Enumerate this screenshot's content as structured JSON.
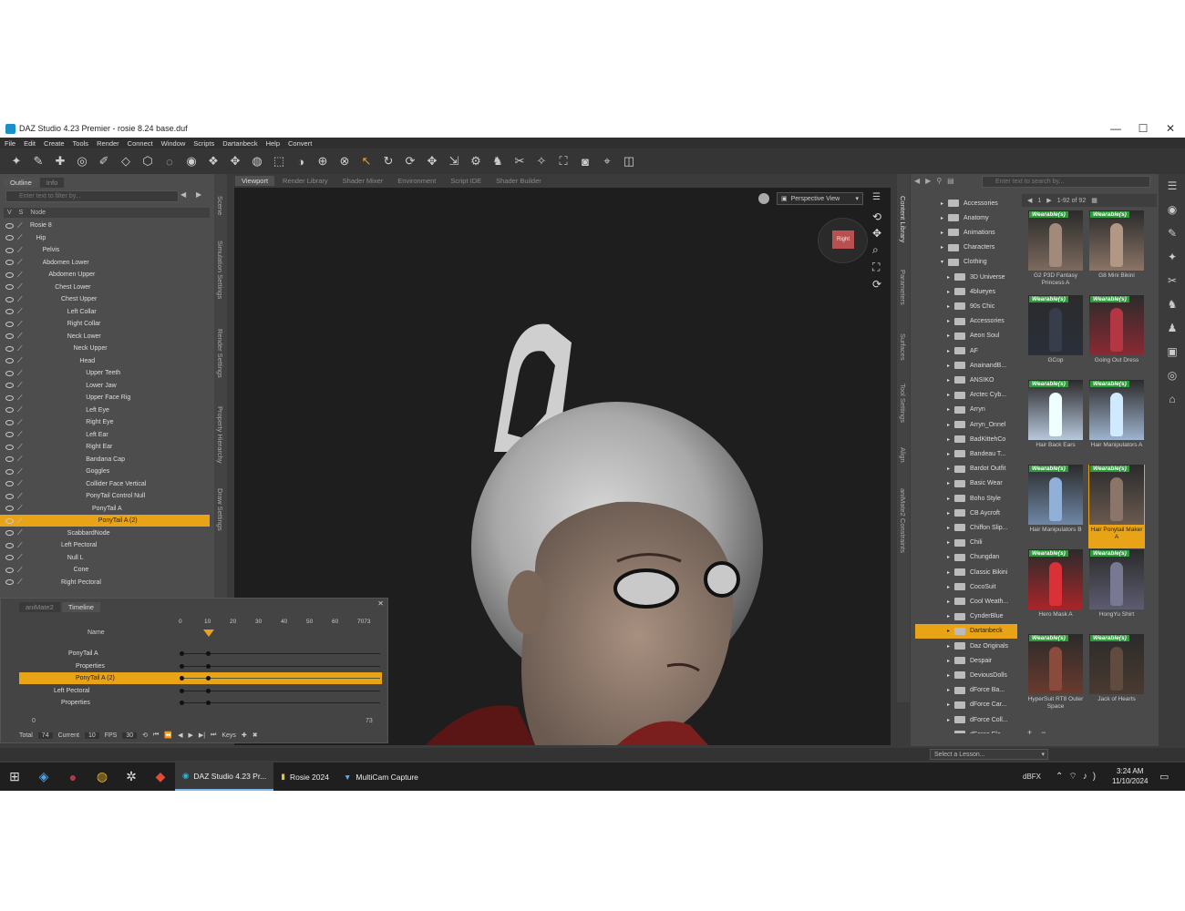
{
  "window": {
    "title": "DAZ Studio 4.23 Premier - rosie 8.24 base.duf",
    "minimize": "—",
    "maximize": "☐",
    "close": "✕"
  },
  "menu": [
    "File",
    "Edit",
    "Create",
    "Tools",
    "Render",
    "Connect",
    "Window",
    "Scripts",
    "Dartanbeck",
    "Help",
    "Convert"
  ],
  "toolbar": {
    "icons": [
      "figure-icon",
      "joint-editor-icon",
      "node-weight-icon",
      "region-nav-icon",
      "surface-select-icon",
      "geometry-icon",
      "polygon-icon",
      "lasso-icon",
      "spot-render-icon",
      "universal-icon",
      "rotate-icon",
      "translate-icon",
      "scale-icon",
      "bend-icon",
      "active-pose-icon",
      "transform-icon",
      "select-icon",
      "orbit-icon",
      "rotate-view-icon",
      "pan-icon",
      "dolly-icon",
      "bone-icon",
      "pose-icon",
      "morph-icon",
      "figure-tool-icon",
      "render-icon",
      "camera-icon",
      "pointer-icon",
      "screenshot-icon"
    ]
  },
  "scene": {
    "tabs": [
      "Outline",
      "Info"
    ],
    "filter_placeholder": "Enter text to filter by...",
    "col_v": "V",
    "col_s": "S",
    "col_node": "Node",
    "nodes": [
      {
        "label": "Rosie 8",
        "indent": 0
      },
      {
        "label": "Hip",
        "indent": 1
      },
      {
        "label": "Pelvis",
        "indent": 2
      },
      {
        "label": "Abdomen Lower",
        "indent": 2
      },
      {
        "label": "Abdomen Upper",
        "indent": 3
      },
      {
        "label": "Chest Lower",
        "indent": 4
      },
      {
        "label": "Chest Upper",
        "indent": 5
      },
      {
        "label": "Left Collar",
        "indent": 6
      },
      {
        "label": "Right Collar",
        "indent": 6
      },
      {
        "label": "Neck Lower",
        "indent": 6
      },
      {
        "label": "Neck Upper",
        "indent": 7
      },
      {
        "label": "Head",
        "indent": 8
      },
      {
        "label": "Upper Teeth",
        "indent": 9
      },
      {
        "label": "Lower Jaw",
        "indent": 9
      },
      {
        "label": "Upper Face Rig",
        "indent": 9
      },
      {
        "label": "Left Eye",
        "indent": 9
      },
      {
        "label": "Right Eye",
        "indent": 9
      },
      {
        "label": "Left Ear",
        "indent": 9
      },
      {
        "label": "Right Ear",
        "indent": 9
      },
      {
        "label": "Bandana Cap",
        "indent": 9
      },
      {
        "label": "Goggles",
        "indent": 9
      },
      {
        "label": "Collider Face Vertical",
        "indent": 9
      },
      {
        "label": "PonyTail Control Null",
        "indent": 9
      },
      {
        "label": "PonyTail A",
        "indent": 10
      },
      {
        "label": "PonyTail A (2)",
        "indent": 11,
        "selected": true
      },
      {
        "label": "ScabbardNode",
        "indent": 6
      },
      {
        "label": "Left Pectoral",
        "indent": 5
      },
      {
        "label": "Null L",
        "indent": 6
      },
      {
        "label": "Cone",
        "indent": 7
      },
      {
        "label": "Right Pectoral",
        "indent": 5
      }
    ]
  },
  "side_tabs_left": [
    "Scene",
    "Simulation Settings",
    "Render Settings",
    "Property Hierarchy",
    "Draw Settings"
  ],
  "side_tabs_right": [
    "Content Library",
    "Parameters",
    "Surfaces",
    "Tool Settings",
    "Align",
    "aniMate2 Constraints"
  ],
  "viewport_tabs": [
    "Viewport",
    "Render Library",
    "Shader Mixer",
    "Environment",
    "Script IDE",
    "Shader Builder"
  ],
  "viewport": {
    "view": "Perspective View",
    "cube_label": "Right"
  },
  "timeline": {
    "tabs": [
      "aniMate2",
      "Timeline"
    ],
    "name_header": "Name",
    "ruler": [
      "0",
      "10",
      "20",
      "30",
      "40",
      "50",
      "60",
      "7073"
    ],
    "rows": [
      {
        "label": "PonyTail A",
        "indent": 3
      },
      {
        "label": "Properties",
        "indent": 4
      },
      {
        "label": "PonyTail A (2)",
        "indent": 4,
        "selected": true
      },
      {
        "label": "Left Pectoral",
        "indent": 1
      },
      {
        "label": "Properties",
        "indent": 2
      }
    ],
    "range_start": "0",
    "range_end": "73",
    "total_label": "Total",
    "total": "74",
    "current_label": "Current",
    "current": "10",
    "fps_label": "FPS",
    "fps": "30",
    "keys_label": "Keys"
  },
  "content": {
    "search_placeholder": "Enter text to search by...",
    "count": "1-92 of 92",
    "page": "1",
    "categories": [
      {
        "label": "Accessories",
        "level": 0
      },
      {
        "label": "Anatomy",
        "level": 0
      },
      {
        "label": "Animations",
        "level": 0
      },
      {
        "label": "Characters",
        "level": 0
      },
      {
        "label": "Clothing",
        "level": 0
      },
      {
        "label": "3D Universe",
        "level": 1
      },
      {
        "label": "4blueyes",
        "level": 1
      },
      {
        "label": "90s Chic",
        "level": 1
      },
      {
        "label": "Accessories",
        "level": 1
      },
      {
        "label": "Aeon Soul",
        "level": 1
      },
      {
        "label": "AF",
        "level": 1
      },
      {
        "label": "AnainandB...",
        "level": 1
      },
      {
        "label": "ANSIKO",
        "level": 1
      },
      {
        "label": "Arctec Cyb...",
        "level": 1
      },
      {
        "label": "Arryn",
        "level": 1
      },
      {
        "label": "Arryn_Onnel",
        "level": 1
      },
      {
        "label": "BadKittehCo",
        "level": 1
      },
      {
        "label": "Bandeau T...",
        "level": 1
      },
      {
        "label": "Bardot Outfit",
        "level": 1
      },
      {
        "label": "Basic Wear",
        "level": 1
      },
      {
        "label": "Boho Style",
        "level": 1
      },
      {
        "label": "CB Aycroft",
        "level": 1
      },
      {
        "label": "Chiffon Slip...",
        "level": 1
      },
      {
        "label": "Chili",
        "level": 1
      },
      {
        "label": "Chungdan",
        "level": 1
      },
      {
        "label": "Classic Bikini",
        "level": 1
      },
      {
        "label": "CocoSuit",
        "level": 1
      },
      {
        "label": "Cool Weath...",
        "level": 1
      },
      {
        "label": "CynderBlue",
        "level": 1
      },
      {
        "label": "Dartanbeck",
        "level": 1,
        "selected": true
      },
      {
        "label": "Daz Originals",
        "level": 1
      },
      {
        "label": "Despair",
        "level": 1
      },
      {
        "label": "DeviousDolls",
        "level": 1
      },
      {
        "label": "dForce Ba...",
        "level": 1
      },
      {
        "label": "dForce Car...",
        "level": 1
      },
      {
        "label": "dForce Coll...",
        "level": 1
      },
      {
        "label": "dForce Ele...",
        "level": 1
      }
    ],
    "badge": "Wearable(s)",
    "items": [
      {
        "label": "G2 P3D Fantasy Princess A",
        "color": "#7c6a5e"
      },
      {
        "label": "G8 Mini Bikini",
        "color": "#8a7466"
      },
      {
        "label": "GCop",
        "color": "#2a2f3a"
      },
      {
        "label": "Going Out Dress",
        "color": "#8a2a33"
      },
      {
        "label": "Hair Back Ears",
        "color": "#b8c8dc"
      },
      {
        "label": "Hair Manipulators A",
        "color": "#9fb4cf"
      },
      {
        "label": "Hair Manipulators B",
        "color": "#6f87a6"
      },
      {
        "label": "Hair Ponytail Maker A",
        "color": "#6a5a50",
        "selected": true
      },
      {
        "label": "Hero Mask A",
        "color": "#a8252a"
      },
      {
        "label": "HongYu Shirt",
        "color": "#5c5c70"
      },
      {
        "label": "HyperSuit RT8 Outer Space",
        "color": "#6a3a2e"
      },
      {
        "label": "Jack of Hearts",
        "color": "#4a3a30"
      }
    ],
    "lesson_placeholder": "Select a Lesson..."
  },
  "taskbar": {
    "apps": [
      {
        "label": "DAZ Studio 4.23 Pr...",
        "active": true
      },
      {
        "label": "Rosie 2024"
      },
      {
        "label": "MultiCam Capture"
      }
    ],
    "tray_text": "dBFX",
    "time": "3:24 AM",
    "date": "11/10/2024"
  }
}
